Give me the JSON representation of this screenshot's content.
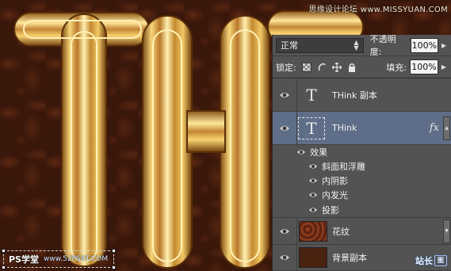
{
  "canvas": {
    "artwork_text": "TH",
    "watermark_top": "思缘设计论坛 www.MISSYUAN.COM",
    "watermark_ps": "PS学堂",
    "watermark_url": "www.52PSXT.COM",
    "colors": {
      "background": "#3a170b",
      "gold": "#d9a13b"
    }
  },
  "layers_panel": {
    "blend_mode": "正常",
    "opacity_label": "不透明度:",
    "opacity_value": "100%",
    "lock_label": "锁定:",
    "fill_label": "填充:",
    "fill_value": "100%",
    "layers": [
      {
        "name": "THink 副本",
        "type": "text",
        "thumb": "T",
        "selected": false
      },
      {
        "name": "THink",
        "type": "text",
        "thumb": "T",
        "selected": true,
        "fx": "fx"
      },
      {
        "name": "花纹",
        "type": "image",
        "selected": false
      },
      {
        "name": "背景副本",
        "type": "image",
        "selected": false
      }
    ],
    "effects_header": "效果",
    "effects": [
      "斜面和浮雕",
      "内阴影",
      "内发光",
      "投影"
    ],
    "watermark_right": "站长",
    "watermark_right_badge": "图",
    "colors": {
      "selected": "#5f6e88",
      "panel": "#535353"
    }
  }
}
